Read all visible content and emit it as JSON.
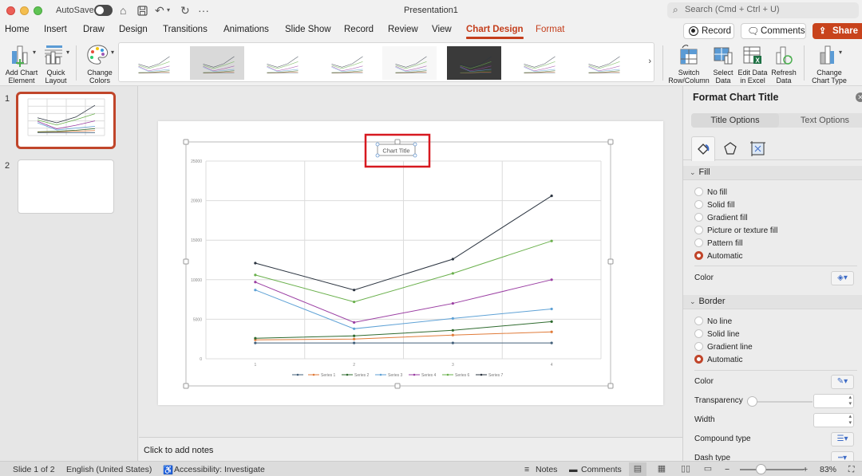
{
  "titlebar": {
    "autosave_label": "AutoSave",
    "doc_title": "Presentation1",
    "search_placeholder": "Search (Cmd + Ctrl + U)"
  },
  "tabs": [
    {
      "label": "Home"
    },
    {
      "label": "Insert"
    },
    {
      "label": "Draw"
    },
    {
      "label": "Design"
    },
    {
      "label": "Transitions"
    },
    {
      "label": "Animations"
    },
    {
      "label": "Slide Show"
    },
    {
      "label": "Record"
    },
    {
      "label": "Review"
    },
    {
      "label": "View"
    },
    {
      "label": "Chart Design"
    },
    {
      "label": "Format"
    }
  ],
  "active_tab": "Chart Design",
  "ribbon_buttons": {
    "record": "Record",
    "comments": "Comments",
    "share": "Share"
  },
  "ribbon": {
    "add_chart_element": [
      "Add Chart",
      "Element"
    ],
    "quick_layout": [
      "Quick",
      "Layout"
    ],
    "change_colors": [
      "Change",
      "Colors"
    ],
    "switch_row_column": [
      "Switch",
      "Row/Column"
    ],
    "select_data": [
      "Select",
      "Data"
    ],
    "edit_data_excel": [
      "Edit Data",
      "in Excel"
    ],
    "refresh_data": [
      "Refresh",
      "Data"
    ],
    "change_chart_type": [
      "Change",
      "Chart Type"
    ],
    "style_count": 8,
    "selected_style": 2
  },
  "slides": [
    {
      "number": "1",
      "selected": true
    },
    {
      "number": "2",
      "selected": false
    }
  ],
  "notes_placeholder": "Click to add notes",
  "pane": {
    "title": "Format Chart Title",
    "tabs": [
      "Title Options",
      "Text Options"
    ],
    "fill": {
      "header": "Fill",
      "options": [
        "No fill",
        "Solid fill",
        "Gradient fill",
        "Picture or texture fill",
        "Pattern fill",
        "Automatic"
      ],
      "selected": "Automatic",
      "color_label": "Color"
    },
    "border": {
      "header": "Border",
      "options": [
        "No line",
        "Solid line",
        "Gradient line",
        "Automatic"
      ],
      "selected": "Automatic",
      "color_label": "Color",
      "transparency_label": "Transparency",
      "width_label": "Width",
      "compound_label": "Compound type",
      "dash_label": "Dash type"
    }
  },
  "status": {
    "slide_of": "Slide 1 of 2",
    "language": "English (United States)",
    "accessibility": "Accessibility: Investigate",
    "notes": "Notes",
    "comments": "Comments",
    "zoom": "83%"
  },
  "chart_data": {
    "type": "line",
    "title": "Chart Title",
    "xlabel": "",
    "ylabel": "",
    "x": [
      "1",
      "2",
      "3",
      "4"
    ],
    "ylim": [
      0,
      25000
    ],
    "yticks": [
      "0",
      "5000",
      "10000",
      "15000",
      "20000",
      "25000"
    ],
    "grid": true,
    "legend": "bottom",
    "series": [
      {
        "name": "",
        "color": "#44617b",
        "values": [
          2000,
          2000,
          2000,
          2000
        ]
      },
      {
        "name": "Series 1",
        "color": "#e07b39",
        "values": [
          2400,
          2500,
          3000,
          3400
        ]
      },
      {
        "name": "Series 2",
        "color": "#2f6b2f",
        "values": [
          2600,
          2900,
          3600,
          4700
        ]
      },
      {
        "name": "Series 3",
        "color": "#5fa2d6",
        "values": [
          8700,
          3800,
          5100,
          6300
        ]
      },
      {
        "name": "Series 4",
        "color": "#9b3fa3",
        "values": [
          9700,
          4600,
          7000,
          10000
        ]
      },
      {
        "name": "Series 6",
        "color": "#6ab04c",
        "values": [
          10600,
          7200,
          10800,
          14900
        ]
      },
      {
        "name": "Series 7",
        "color": "#2b3440",
        "values": [
          12100,
          8700,
          12600,
          20600
        ]
      }
    ]
  }
}
